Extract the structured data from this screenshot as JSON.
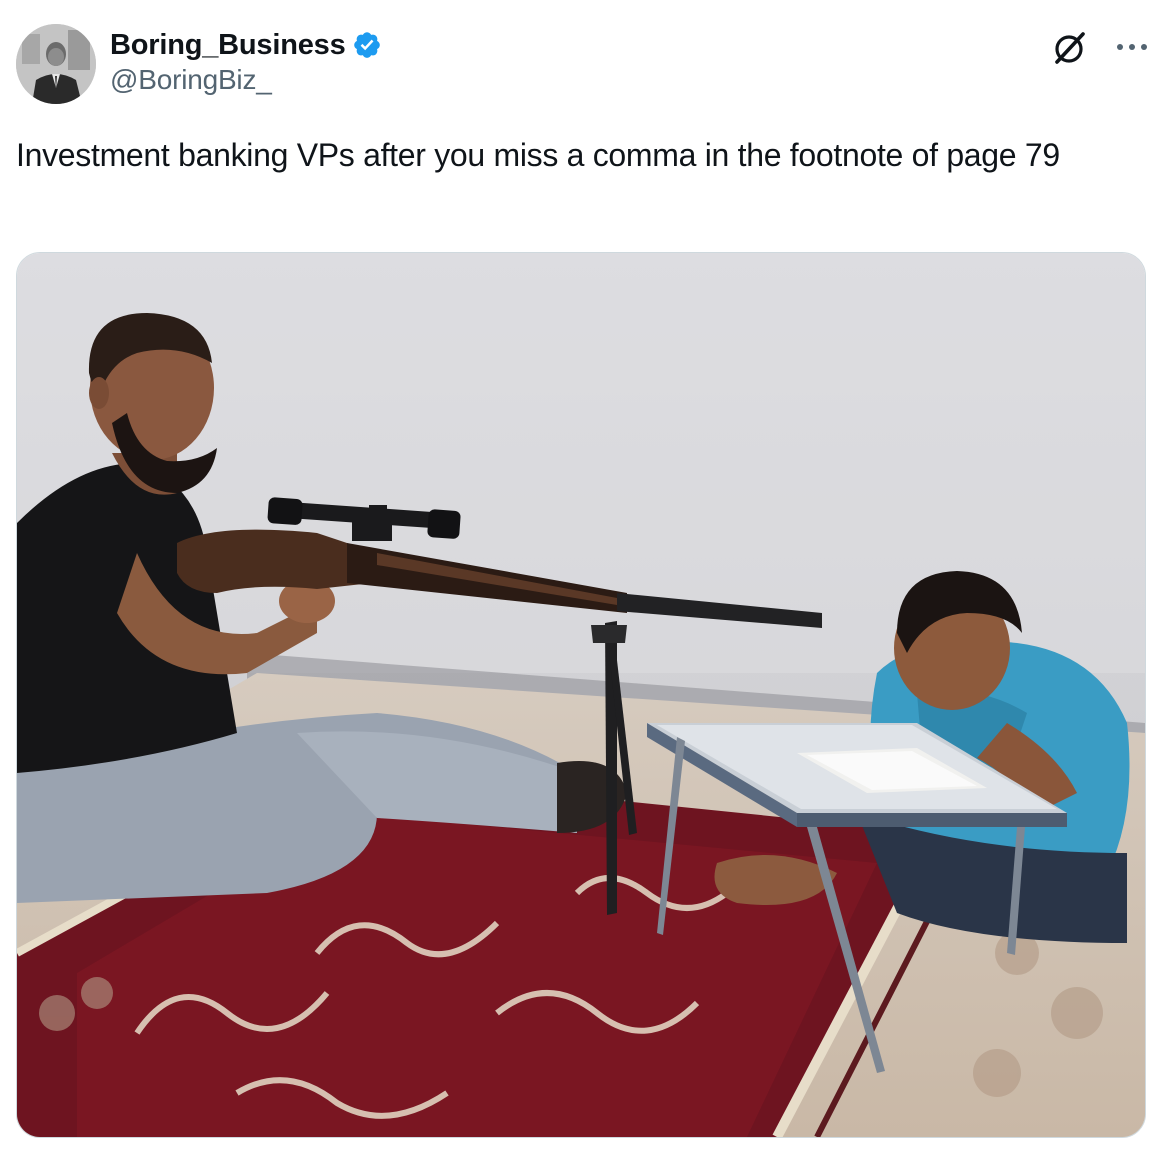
{
  "author": {
    "display_name": "Boring_Business",
    "handle": "@BoringBiz_",
    "verified": true,
    "avatar_icon": "avatar-portrait-man-in-suit"
  },
  "tweet": {
    "text": "Investment banking VPs after you miss a comma in the footnote of page 79"
  },
  "actions": {
    "grok_icon": "grok-icon",
    "more_icon": "more-horizontal-icon"
  },
  "colors": {
    "text": "#0f1419",
    "secondary_text": "#536471",
    "verified_blue": "#1d9bf0",
    "border": "#cfd9de"
  }
}
